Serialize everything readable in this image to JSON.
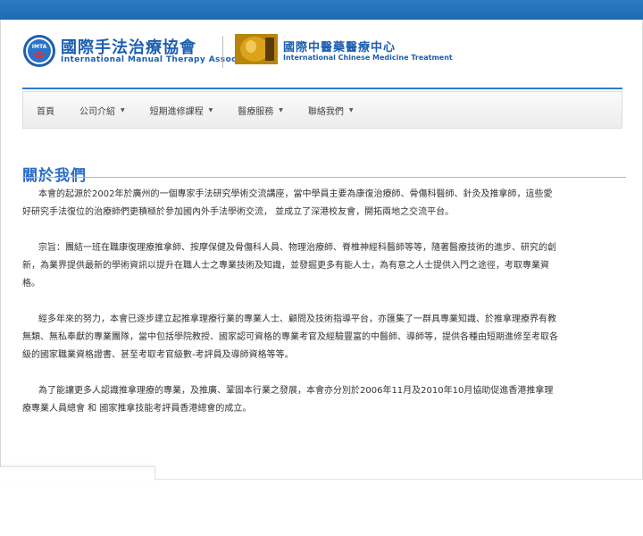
{
  "colors": {
    "brand_blue": "#1c5fb0",
    "accent": "#2b6cc4",
    "top_bar": "#1f6ab0"
  },
  "header": {
    "logo_primary": {
      "badge_text": "IMTA",
      "zh": "國際手法治療協會",
      "en": "International Manual Therapy Association"
    },
    "logo_secondary": {
      "zh": "國際中醫藥醫療中心",
      "en": "International Chinese Medicine Treatment"
    }
  },
  "nav": {
    "items": [
      {
        "label": "首頁",
        "dropdown": false
      },
      {
        "label": "公司介紹",
        "dropdown": true
      },
      {
        "label": "短期進修課程",
        "dropdown": true
      },
      {
        "label": "醫療服務",
        "dropdown": true
      },
      {
        "label": "聯絡我們",
        "dropdown": true
      }
    ],
    "caret_icon": "▼"
  },
  "main": {
    "title": "關於我們",
    "para1": {
      "text": "本會的起源於2002年於廣州的一個專家手法研究學術交流講座，當中學員主要為康復治療師、骨傷科醫師、針灸及推拿師，這些愛好研究手法復位的治療師們更積極於參加國內外手法學術交流， 並成立了",
      "link": "深港校友會",
      "text_after": "，開拓兩地之交流平台。"
    },
    "para2": {
      "text": "宗旨：團結一班在職康復理療推拿師、按摩保健及骨傷科人員、物理治療師、脊椎神經科醫師等等，隨著醫療技術的進步、研究的創新，為業界提供最新的學術資訊以提升在職人士之專業技術及知識，並發掘更多有能人士，為有意之人士提供入門之途徑，考取專業資格。"
    },
    "para3": {
      "text": "經多年來的努力，本會已逐步建立起推拿理療行業的專業人士、顧問及技術指導平台，亦匯集了一群具專業知識、於推拿理療界有教無類、無私奉獻的專業團隊，當中包括學院教授、國家認可資格的專業考官及經驗豐富的中醫師、導師等，提供各種由短期進修至考取各級的國家職業資格證書、甚至考取考官級數-考評員及導師資格等等。"
    },
    "para4": {
      "text": "為了能讓更多人認識推拿理療的專業，及推廣、鞏固本行業之發展，本會亦分別於2006年11月及2010年10月協助促進",
      "link1": "香港推拿理療專業人員總會",
      "mid": " 和 ",
      "link2": "國家推拿技能考評員香港總會",
      "text_after": "的成立。"
    }
  }
}
